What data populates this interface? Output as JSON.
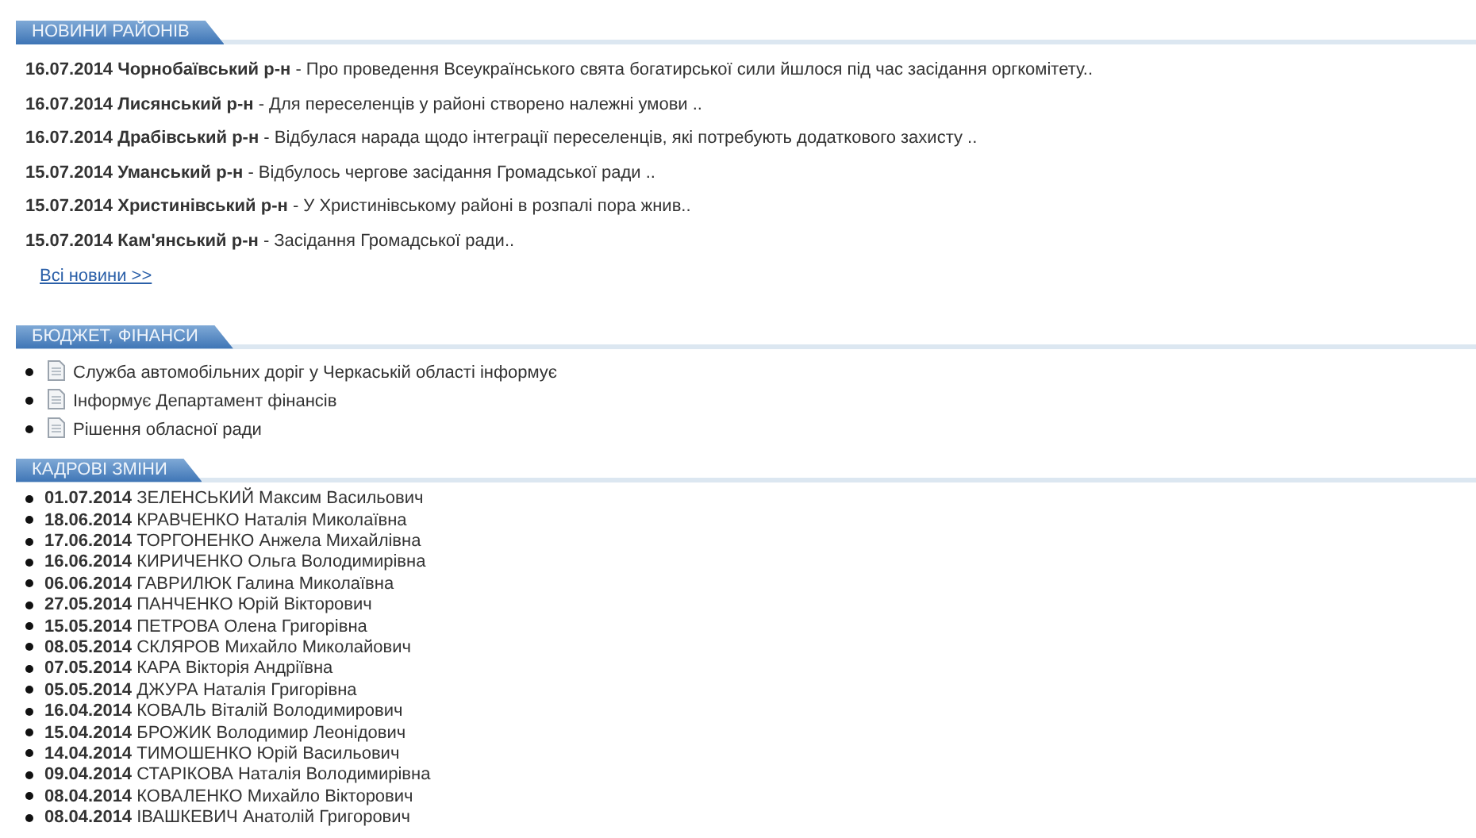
{
  "district_news": {
    "title": "НОВИНИ РАЙОНІВ",
    "items": [
      "**16.07.2014 Чорнобаївський р-н** - Про проведення Всеукраїнського свята богатирської сили йшлося під час засідання оргкомітету..",
      "**16.07.2014 Лисянський р-н** - Для переселенців у районі створено належні умови ..",
      "**16.07.2014 Драбівський р-н** - Відбулася нарада щодо інтеграції переселенців, які потребують додаткового захисту ..",
      "**15.07.2014 Уманський р-н** - Відбулось чергове засідання Громадської ради ..",
      "**15.07.2014 Христинівський р-н** - У Христинівському районі в розпалі пора жнив..",
      "**15.07.2014 Кам'янський р-н** - Засідання Громадської ради.."
    ],
    "all_news_link": "Всі новини >>"
  },
  "budget_finance": {
    "title": "БЮДЖЕТ, ФІНАНСИ",
    "documents": [
      "Служба автомобільних доріг у Черкаській області інформує",
      "Інформує Департамент фінансів",
      "Рішення обласної ради"
    ]
  },
  "personnel_changes": {
    "title": "КАДРОВІ ЗМІНИ",
    "items": [
      "**01.07.2014** ЗЕЛЕНСЬКИЙ Максим Васильович",
      "**18.06.2014** КРАВЧЕНКО Наталія Миколаївна",
      "**17.06.2014** ТОРГОНЕНКО Анжела Михайлівна",
      "**16.06.2014** КИРИЧЕНКО Ольга Володимирівна",
      "**06.06.2014** ГАВРИЛЮК Галина Миколаївна",
      "**27.05.2014** ПАНЧЕНКО Юрій Вікторович",
      "**15.05.2014** ПЕТРОВА Олена Григорівна",
      "**08.05.2014** СКЛЯРОВ Михайло Миколайович",
      "**07.05.2014** КАРА Вікторія Андріївна",
      "**05.05.2014** ДЖУРА Наталія Григорівна",
      "**16.04.2014** КОВАЛЬ Віталій Володимирович",
      "**15.04.2014** БРОЖИК Володимир Леонідович",
      "**14.04.2014** ТИМОШЕНКО Юрій Васильович",
      "**09.04.2014** СТАРІКОВА Наталія Володимирівна",
      "**08.04.2014** КОВАЛЕНКО Михайло Вікторович",
      "**08.04.2014** ІВАШКЕВИЧ Анатолій Григорович"
    ]
  }
}
